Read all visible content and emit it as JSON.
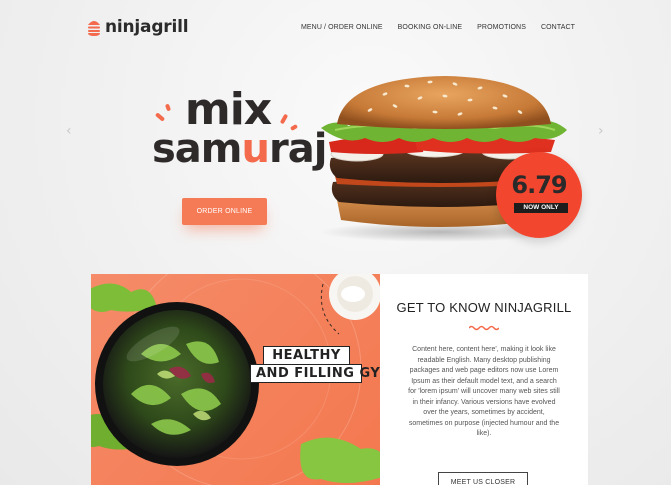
{
  "header": {
    "logo_text": "ninjagrill",
    "nav": [
      {
        "label": "MENU / ORDER ONLINE"
      },
      {
        "label": "BOOKING ON-LINE"
      },
      {
        "label": "PROMOTIONS"
      },
      {
        "label": "CONTACT"
      }
    ]
  },
  "hero": {
    "title_line1": "mix",
    "title_line2_a": "sam",
    "title_line2_b": "u",
    "title_line2_c": "raj",
    "order_button": "ORDER ONLINE",
    "price": "6.79",
    "price_note": "NOW ONLY",
    "arrow_left": "‹",
    "arrow_right": "›"
  },
  "promo": {
    "line1": "HEALTHY",
    "line2": "AND FILLING GYROS"
  },
  "about": {
    "title": "GET TO KNOW NINJAGRILL",
    "body": "Content here, content here', making it look like readable English. Many desktop publishing packages and web page editors now use Lorem Ipsum as their default model text, and a search for 'lorem ipsum' will uncover many web sites still in their infancy. Various versions have evolved over the years, sometimes by accident, sometimes on purpose (injected humour and the like).",
    "button": "MEET US CLOSER"
  },
  "colors": {
    "accent": "#f46a4c",
    "badge": "#f2462f",
    "button": "#f57a56"
  }
}
